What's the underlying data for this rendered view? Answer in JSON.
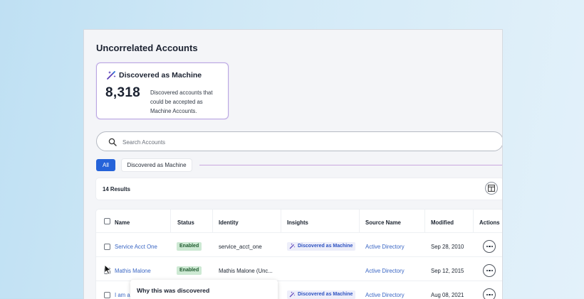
{
  "page": {
    "title": "Uncorrelated Accounts"
  },
  "card": {
    "title": "Discovered as Machine",
    "count": "8,318",
    "description": "Discovered accounts that could be accepted as Machine Accounts.",
    "icon": "magic-wand-icon"
  },
  "search": {
    "placeholder": "Search Accounts",
    "value": "",
    "icon": "search-icon"
  },
  "filters": {
    "all_label": "All",
    "machine_label": "Discovered as Machine"
  },
  "results": {
    "count_label": "14 Results",
    "columns_icon": "table-columns-icon"
  },
  "table": {
    "headers": [
      "Name",
      "Status",
      "Identity",
      "Insights",
      "Source Name",
      "Modified",
      "Actions"
    ],
    "rows": [
      {
        "name": "Service Acct One",
        "status": "Enabled",
        "identity": "service_acct_one",
        "insight": "Discovered as Machine",
        "source": "Active Directory",
        "modified": "Sep 28, 2010"
      },
      {
        "name": "Mathis Malone",
        "status": "Enabled",
        "identity": "Mathis Malone (Unc...",
        "insight": "",
        "source": "Active Directory",
        "modified": "Sep 12, 2015"
      },
      {
        "name": "I am a",
        "status": "",
        "identity": "",
        "insight": "Discovered as Machine",
        "source": "Active Directory",
        "modified": "Aug 08, 2021"
      }
    ]
  },
  "tooltip": {
    "title": "Why this was discovered"
  },
  "colors": {
    "primary": "#2563d9",
    "link": "#3a66c4",
    "accent_purple": "#b9a7e0",
    "status_green": "#cde9d3"
  }
}
